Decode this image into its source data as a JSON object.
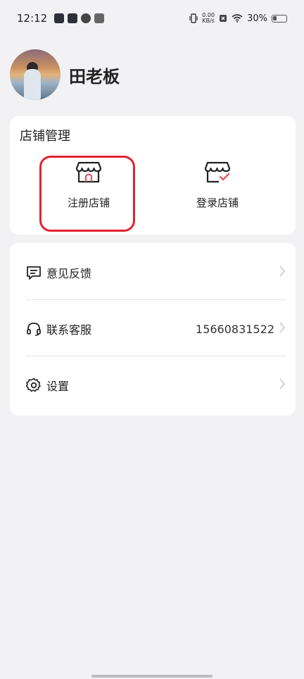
{
  "status_bar": {
    "time": "12:12",
    "net_speed_value": "0.00",
    "net_speed_unit": "KB/s",
    "battery": "30%"
  },
  "profile": {
    "name": "田老板"
  },
  "store_management": {
    "title": "店铺管理",
    "register_label": "注册店铺",
    "login_label": "登录店铺"
  },
  "menu": {
    "items": [
      {
        "label": "意见反馈",
        "icon": "feedback-icon"
      },
      {
        "label": "联系客服",
        "icon": "headset-icon",
        "value": "15660831522"
      },
      {
        "label": "设置",
        "icon": "gear-icon"
      }
    ]
  },
  "colors": {
    "highlight": "#e2232f",
    "background": "#f2f2f4",
    "card": "#ffffff"
  }
}
